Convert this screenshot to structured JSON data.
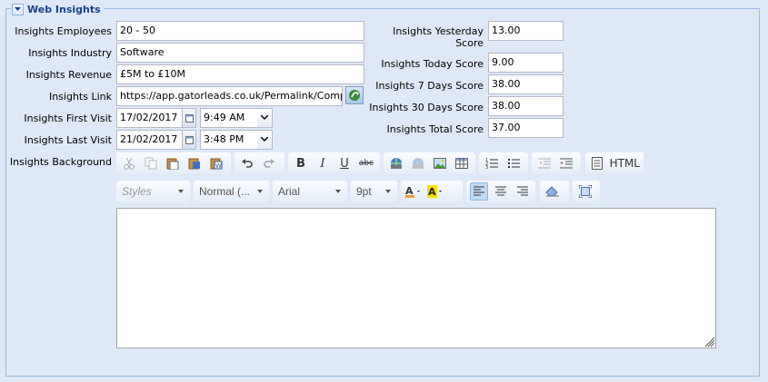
{
  "section": {
    "title": "Web Insights"
  },
  "left_fields": {
    "employees": {
      "label": "Insights Employees",
      "value": "20 - 50"
    },
    "industry": {
      "label": "Insights Industry",
      "value": "Software"
    },
    "revenue": {
      "label": "Insights Revenue",
      "value": "£5M to £10M"
    },
    "link": {
      "label": "Insights Link",
      "value": "https://app.gatorleads.co.uk/Permalink/Company/"
    },
    "first_visit": {
      "label": "Insights First Visit",
      "date": "17/02/2017",
      "time": "9:49 AM"
    },
    "last_visit": {
      "label": "Insights Last Visit",
      "date": "21/02/2017",
      "time": "3:48 PM"
    },
    "background": {
      "label": "Insights Background"
    }
  },
  "right_fields": {
    "yesterday": {
      "label_line1": "Insights Yesterday",
      "label_line2": "Score",
      "value": "13.00"
    },
    "today": {
      "label": "Insights Today Score",
      "value": "9.00"
    },
    "seven_days": {
      "label": "Insights 7 Days Score",
      "value": "38.00"
    },
    "thirty_days": {
      "label": "Insights 30 Days Score",
      "value": "38.00"
    },
    "total": {
      "label": "Insights Total Score",
      "value": "37.00"
    }
  },
  "editor": {
    "html_label": "HTML",
    "bold": "B",
    "italic": "I",
    "underline": "U",
    "strike": "abc",
    "styles": "Styles",
    "format": "Normal (...",
    "font": "Arial",
    "size": "9pt",
    "content": ""
  },
  "colors": {
    "background": "#dfe8f6",
    "border": "#99bbe8",
    "title": "#15428b"
  },
  "icons": [
    "chevron-down-icon",
    "calendar-icon",
    "link-icon",
    "cut-icon",
    "copy-icon",
    "paste-icon",
    "paste-text-icon",
    "paste-word-icon",
    "undo-icon",
    "redo-icon",
    "link-insert-icon",
    "unlink-icon",
    "image-icon",
    "table-icon",
    "ordered-list-icon",
    "bullet-list-icon",
    "outdent-icon",
    "indent-icon",
    "source-icon",
    "eraser-icon",
    "maximize-icon"
  ]
}
